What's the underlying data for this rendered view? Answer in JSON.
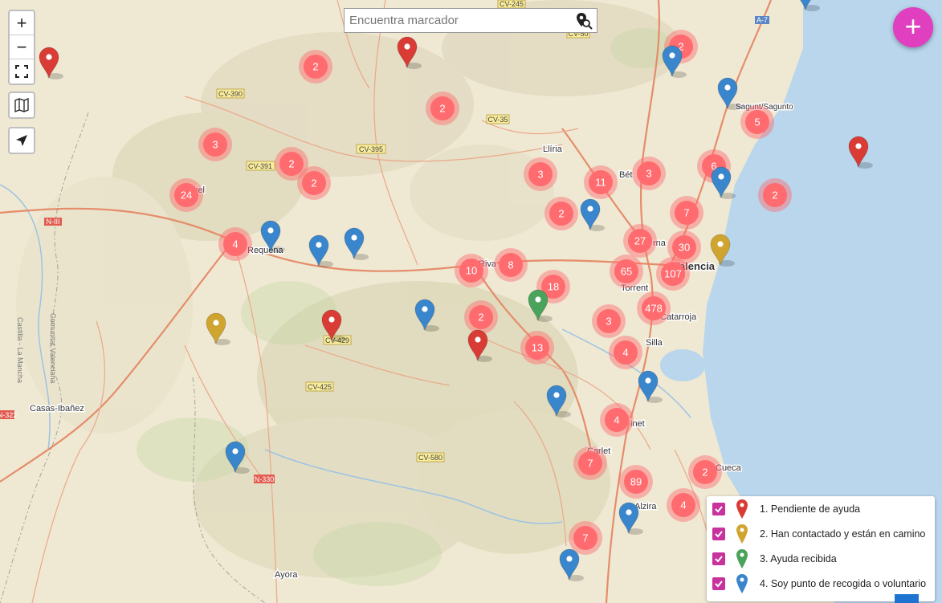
{
  "search": {
    "placeholder": "Encuentra marcador"
  },
  "controls": {
    "zoom_in": "+",
    "zoom_out": "−",
    "fab": "+"
  },
  "legend": [
    {
      "label": "1. Pendiente de ayuda",
      "color": "#d93c34"
    },
    {
      "label": "2. Han contactado y están en camino",
      "color": "#cfa42f"
    },
    {
      "label": "3. Ayuda recibida",
      "color": "#4aa35a"
    },
    {
      "label": "4. Soy punto de recogida o voluntario",
      "color": "#3a86cc"
    }
  ],
  "colors": {
    "cluster": "#ff6b6e",
    "accent": "#e03fbf",
    "sea": "#b8d6ee",
    "land": "#f0ead8"
  },
  "clusters": [
    "2",
    "2",
    "2",
    "3",
    "2",
    "2",
    "24",
    "4",
    "3",
    "11",
    "3",
    "6",
    "2",
    "2",
    "5",
    "7",
    "27",
    "30",
    "10",
    "8",
    "65",
    "107",
    "18",
    "478",
    "2",
    "3",
    "13",
    "4",
    "4",
    "7",
    "89",
    "2",
    "4",
    "7"
  ],
  "places": [
    "Llíria",
    "Bét",
    "Requena",
    "Riva",
    "Torrent",
    "Valencia",
    "Catarroja",
    "Silla",
    "Alzira",
    "Carlet",
    "Casas-Ibañez",
    "Ayora",
    "Sagunt/Sagunto",
    "Cueca",
    "inet",
    "rna",
    "iel"
  ],
  "roads": [
    "CV-245",
    "A-7",
    "CV-390",
    "CV-35",
    "CV-395",
    "CV-391",
    "N-III",
    "CV-429",
    "CV-425",
    "CV-580",
    "N-330",
    "N-322",
    "CV-50"
  ],
  "map_labels": [
    "Comunitat Valenciana",
    "Castilla - La Mancha"
  ]
}
